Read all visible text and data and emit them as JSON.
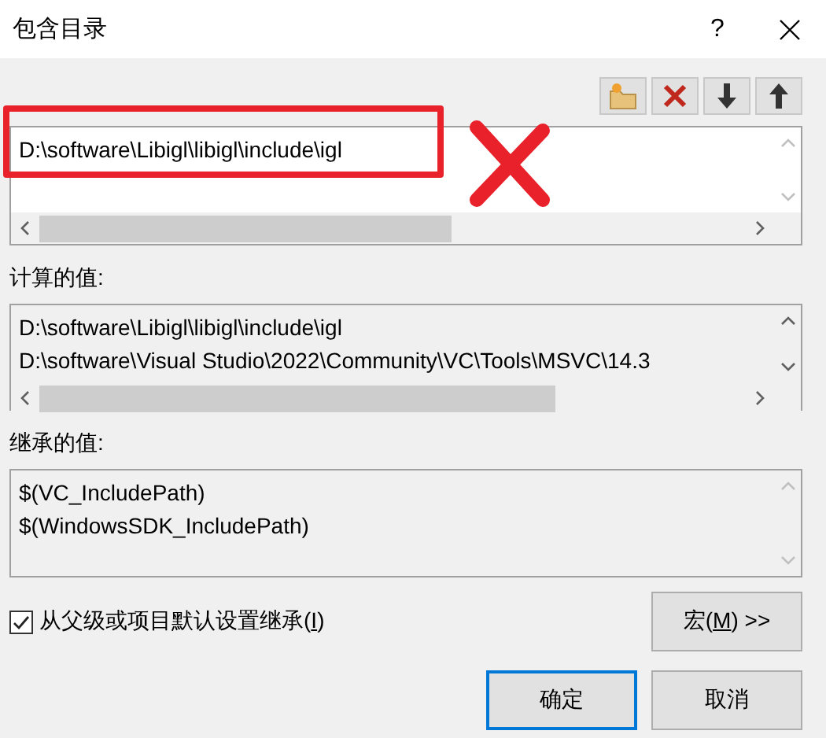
{
  "window": {
    "title": "包含目录",
    "help": "?"
  },
  "toolbar": [
    {
      "kind": "new-folder"
    },
    {
      "kind": "delete"
    },
    {
      "kind": "down"
    },
    {
      "kind": "up"
    }
  ],
  "entries": [
    "D:\\software\\Libigl\\libigl\\include\\igl"
  ],
  "annotations": [
    {
      "kind": "box"
    },
    {
      "kind": "cross"
    }
  ],
  "computed": {
    "label": "计算的值:",
    "lines": [
      "D:\\software\\Libigl\\libigl\\include\\igl",
      "D:\\software\\Visual Studio\\2022\\Community\\VC\\Tools\\MSVC\\14.3"
    ]
  },
  "inherited": {
    "label": "继承的值:",
    "lines": [
      "$(VC_IncludePath)",
      "$(WindowsSDK_IncludePath)"
    ]
  },
  "inherit_checkbox": {
    "label_before": "从父级或项目默认设置继承(",
    "access_key": "I",
    "label_after": ")",
    "checked": true
  },
  "macro_button": {
    "before": "宏(",
    "access_key": "M",
    "after": ") >>"
  },
  "buttons": [
    {
      "label": "确定",
      "selected": true
    },
    {
      "label": "取消",
      "selected": false
    }
  ]
}
